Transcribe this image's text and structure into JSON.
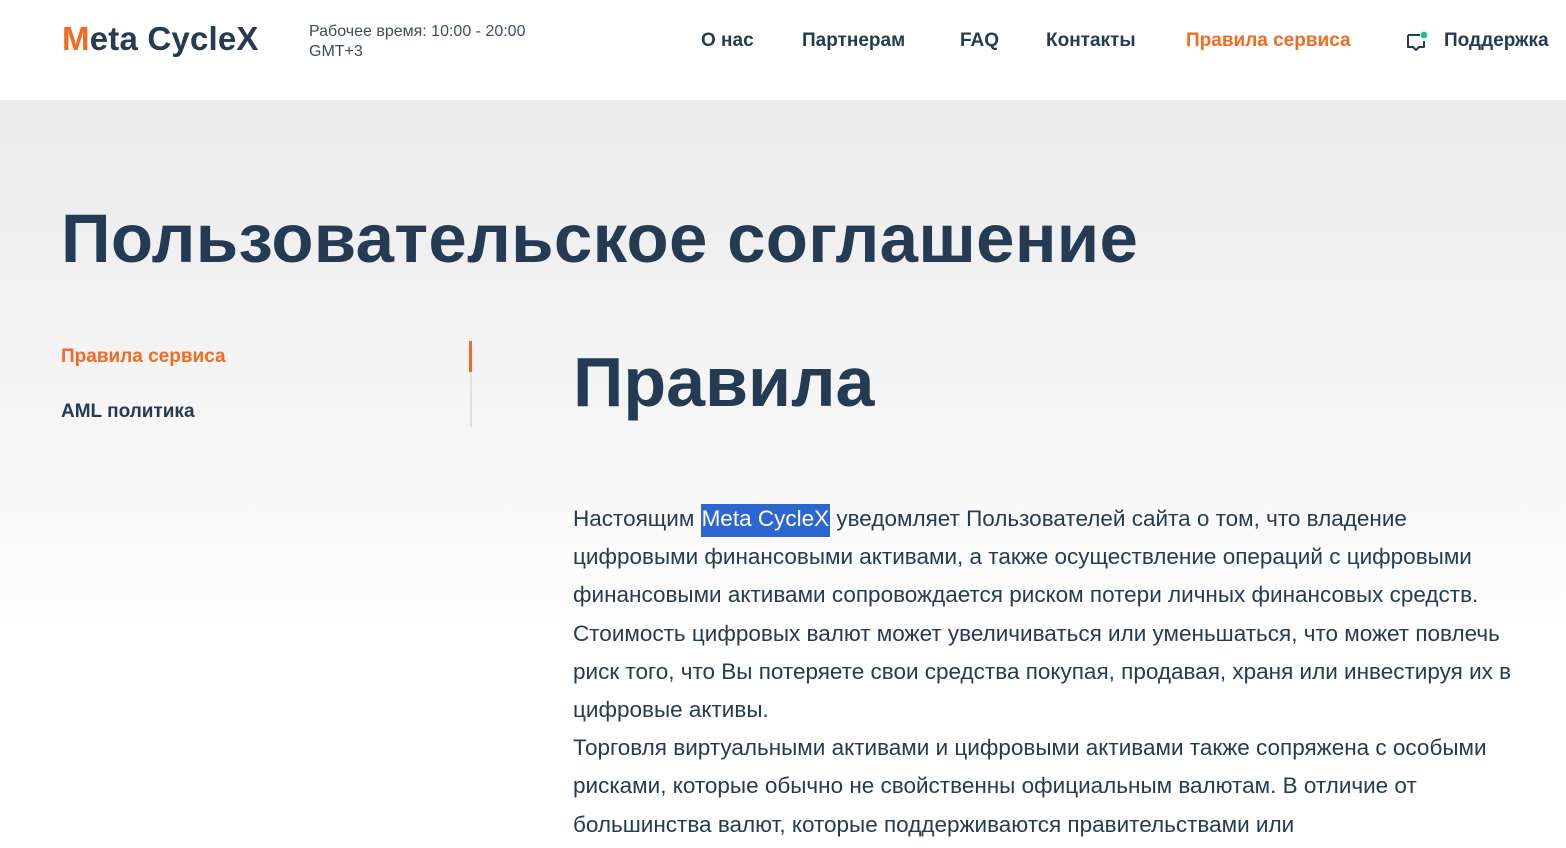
{
  "header": {
    "logo_first_letter": "M",
    "logo_rest": "eta CycleX",
    "hours_line1": "Рабочее время: 10:00 - 20:00",
    "hours_line2": "GMT+3",
    "nav": [
      {
        "label": "О нас"
      },
      {
        "label": "Партнерам"
      },
      {
        "label": "FAQ"
      },
      {
        "label": "Контакты"
      },
      {
        "label": "Правила сервиса",
        "active": true
      },
      {
        "label": "Поддержка",
        "icon": "chat-icon"
      }
    ]
  },
  "page": {
    "title": "Пользовательское соглашение"
  },
  "sidebar": {
    "items": [
      {
        "label": "Правила сервиса",
        "active": true
      },
      {
        "label": "AML политика"
      }
    ]
  },
  "content": {
    "heading": "Правила",
    "p1_before": "Настоящим ",
    "p1_highlight": "Meta CycleX",
    "p1_after": " уведомляет Пользователей сайта о том, что владение цифровыми финансовыми активами, а также осуществление операций с цифровыми финансовыми активами сопровождается риском потери личных финансовых средств. Стоимость цифровых валют может увеличиваться или уменьшаться, что может повлечь риск того, что Вы потеряете свои средства покупая, продавая, храня или инвестируя их в цифровые активы.",
    "p2": "Торговля виртуальными активами и цифровыми активами также сопряжена с особыми рисками, которые обычно не свойственны официальным валютам. В отличие от большинства валют, которые поддерживаются правительствами или"
  },
  "colors": {
    "accent": "#f26b21",
    "text": "#243b53",
    "selection": "#2e66cf",
    "support_dot": "#1fbf8f"
  }
}
